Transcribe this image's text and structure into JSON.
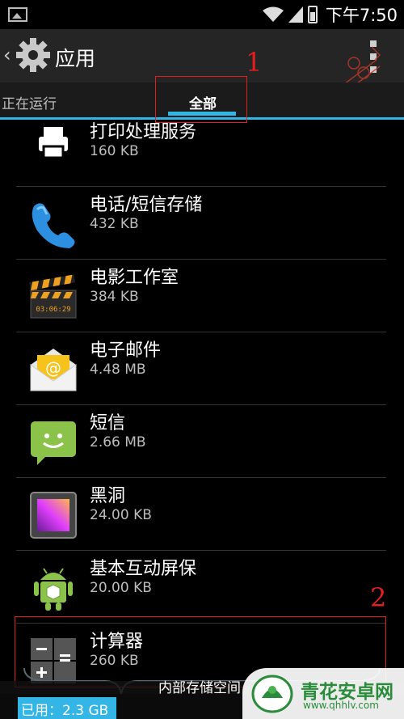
{
  "status_bar": {
    "time": "下午7:50"
  },
  "action_bar": {
    "title": "应用"
  },
  "tabs": {
    "running": "正在运行",
    "all": "全部"
  },
  "annotations": {
    "label_1": "1",
    "label_2": "2"
  },
  "apps": [
    {
      "name": "打印处理服务",
      "size": "160 KB",
      "icon": "print-icon"
    },
    {
      "name": "电话/短信存储",
      "size": "432 KB",
      "icon": "phone-icon"
    },
    {
      "name": "电影工作室",
      "size": "384 KB",
      "icon": "clapperboard-icon",
      "icon_text": "03:06:29"
    },
    {
      "name": "电子邮件",
      "size": "4.48 MB",
      "icon": "email-icon"
    },
    {
      "name": "短信",
      "size": "2.66 MB",
      "icon": "message-icon"
    },
    {
      "name": "黑洞",
      "size": "24.00 KB",
      "icon": "blackhole-icon"
    },
    {
      "name": "基本互动屏保",
      "size": "20.00 KB",
      "icon": "android-icon"
    },
    {
      "name": "计算器",
      "size": "260 KB",
      "icon": "calculator-icon"
    }
  ],
  "storage": {
    "title": "内部存储空间",
    "used_label": "已用：2.3 GB"
  },
  "watermark_logo": {
    "name": "青花安卓网",
    "url": "www.qhhlv.com"
  },
  "colors": {
    "accent": "#33b5e5",
    "annotation": "#e02020",
    "actionbar": "#252525"
  }
}
